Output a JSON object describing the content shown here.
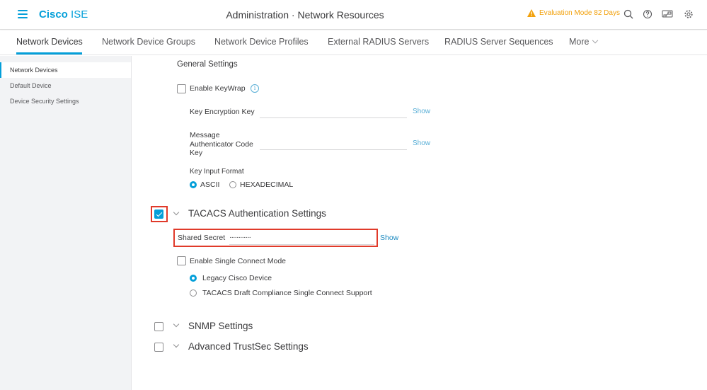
{
  "header": {
    "brand_bold": "Cisco",
    "brand_light": "ISE",
    "title": "Administration · Network Resources",
    "evaluation": "Evaluation Mode 82 Days",
    "icons": [
      "search-icon",
      "help-icon",
      "dashboard-icon",
      "gear-icon"
    ]
  },
  "tabs": [
    {
      "label": "Network Devices",
      "active": true
    },
    {
      "label": "Network Device Groups"
    },
    {
      "label": "Network Device Profiles"
    },
    {
      "label": "External RADIUS Servers"
    },
    {
      "label": "RADIUS Server Sequences"
    },
    {
      "label": "More"
    }
  ],
  "sidebar": {
    "items": [
      {
        "label": "Network Devices",
        "active": true
      },
      {
        "label": "Default Device"
      },
      {
        "label": "Device Security Settings"
      }
    ]
  },
  "general": {
    "title": "General Settings",
    "keywrap_label": "Enable KeyWrap",
    "kek_label": "Key Encryption Key",
    "mack_label_1": "Message",
    "mack_label_2": "Authenticator Code",
    "mack_label_3": "Key",
    "show": "Show",
    "key_input_format_label": "Key Input Format",
    "format_ascii": "ASCII",
    "format_hex": "HEXADECIMAL"
  },
  "tacacs": {
    "title": "TACACS Authentication Settings",
    "checked": true,
    "shared_secret_label": "Shared Secret",
    "shared_secret_value": "············",
    "show": "Show",
    "single_connect_label": "Enable Single Connect Mode",
    "legacy_label": "Legacy Cisco Device",
    "draft_label": "TACACS Draft Compliance Single Connect Support"
  },
  "snmp": {
    "title": "SNMP Settings"
  },
  "trustsec": {
    "title": "Advanced TrustSec Settings"
  }
}
